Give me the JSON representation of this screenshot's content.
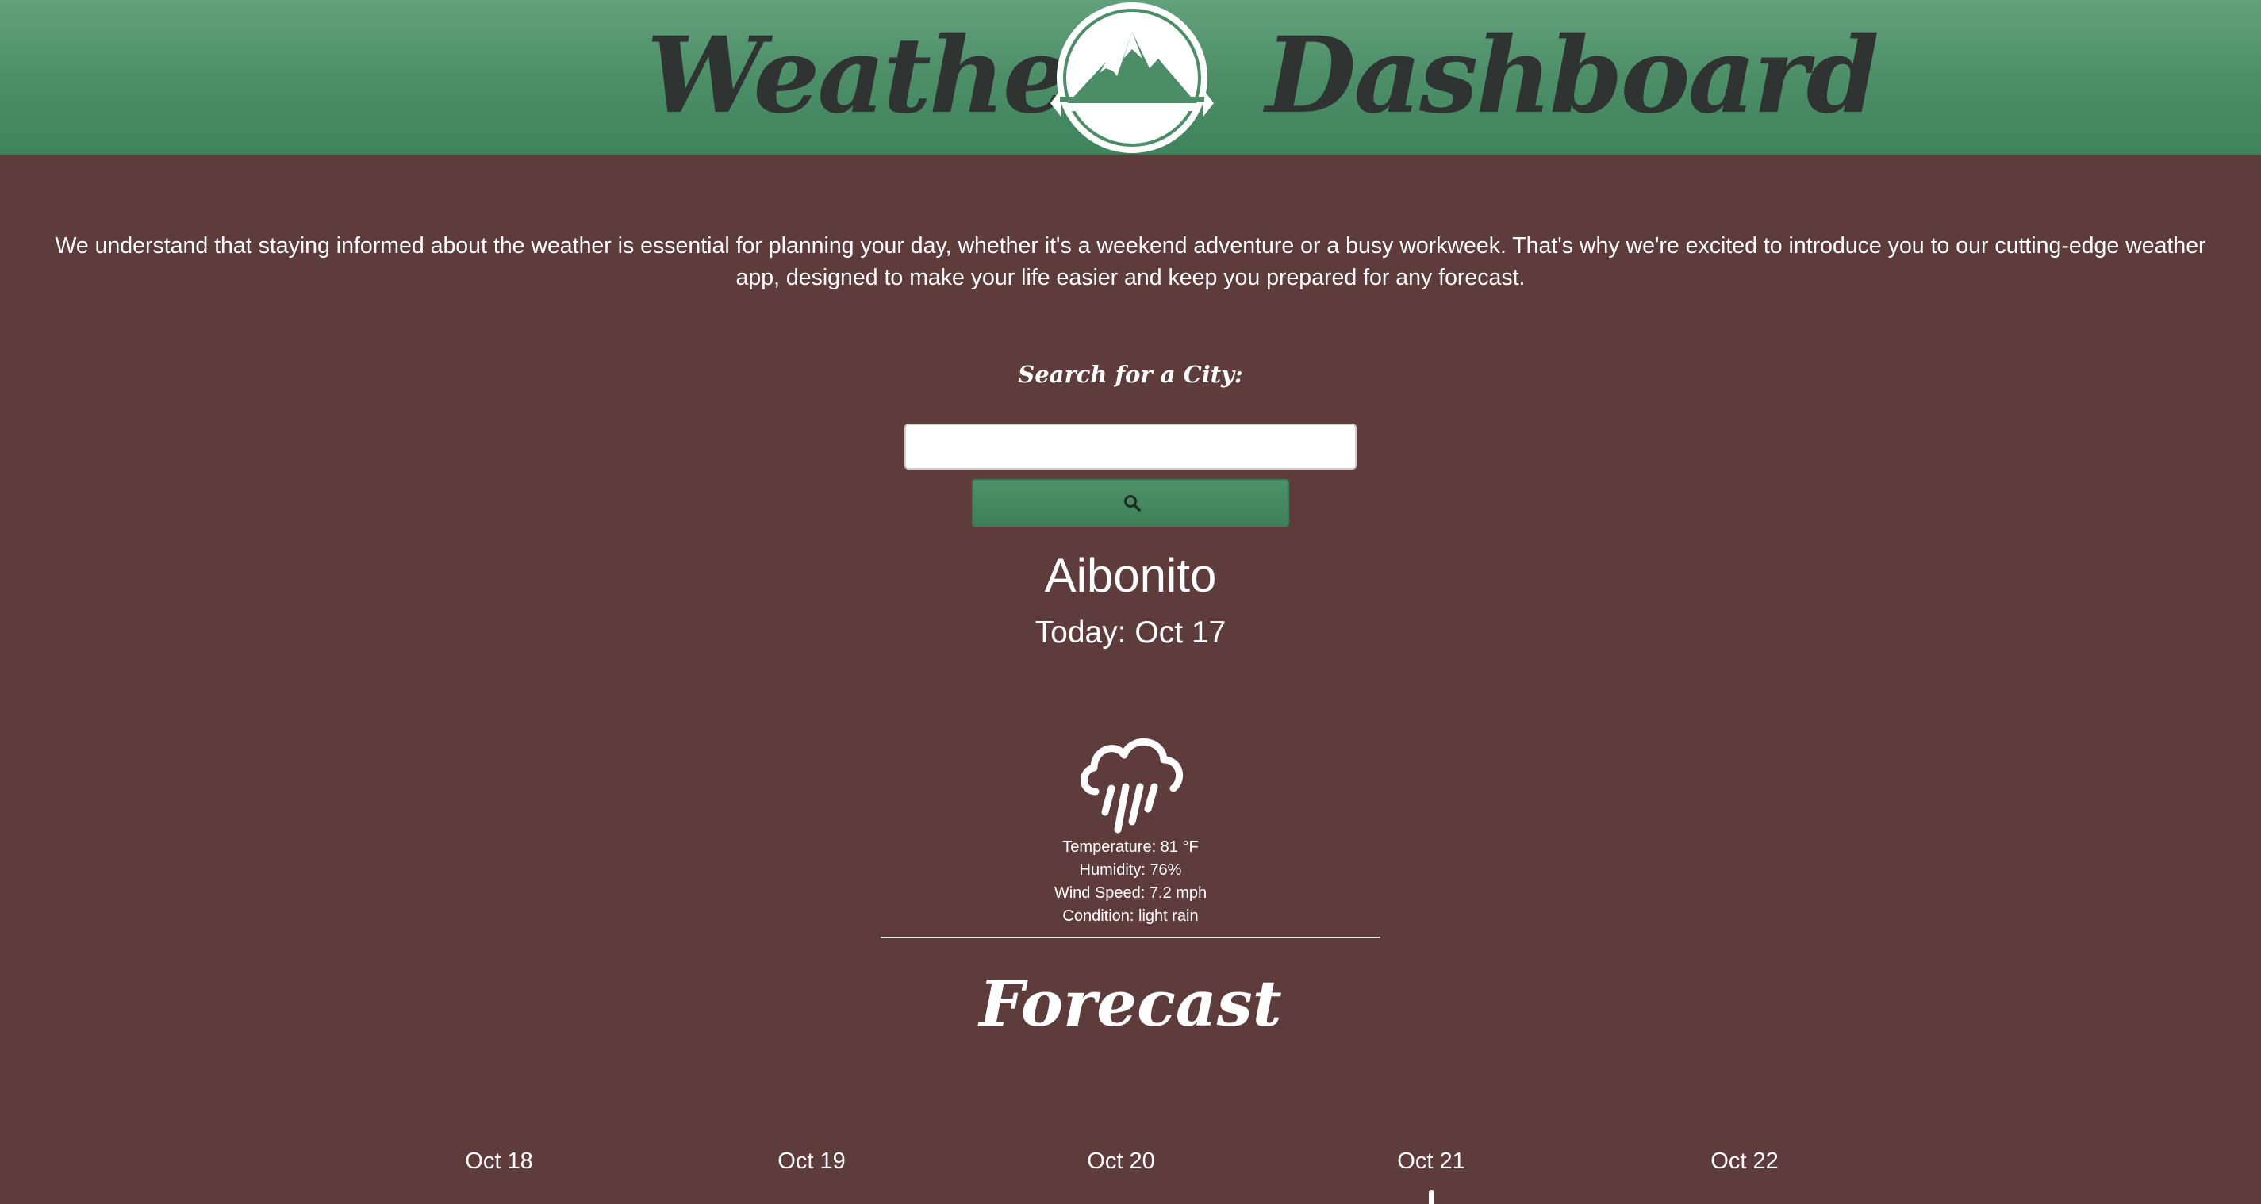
{
  "header": {
    "title_left": "Weather",
    "title_right": "Dashboard",
    "logo_icon": "mountain-logo-icon",
    "colors": {
      "header_green": "#4b8d66",
      "title_text": "#2f3432"
    }
  },
  "intro": {
    "text": "We understand that staying informed about the weather is essential for planning your day, whether it's a weekend adventure or a busy workweek. That's why we're excited to introduce you to our cutting-edge weather app, designed to make your life easier and keep you prepared for any forecast."
  },
  "search": {
    "label": "Search for a City:",
    "value": "",
    "placeholder": "",
    "button_icon": "search-icon"
  },
  "current": {
    "city": "Aibonito",
    "date_text": "Today: Oct 17",
    "icon": "rain-cloud-icon",
    "temperature": "Temperature: 81 °F",
    "humidity": "Humidity: 76%",
    "wind": "Wind Speed: 7.2 mph",
    "condition": "Condition: light rain"
  },
  "forecast": {
    "heading": "Forecast",
    "days": [
      {
        "date": "Oct 18"
      },
      {
        "date": "Oct 19"
      },
      {
        "date": "Oct 20"
      },
      {
        "date": "Oct 21"
      },
      {
        "date": "Oct 22"
      }
    ]
  },
  "colors": {
    "background": "#5e3c3c",
    "accent_green": "#4b8d66",
    "text": "#ffffff"
  }
}
